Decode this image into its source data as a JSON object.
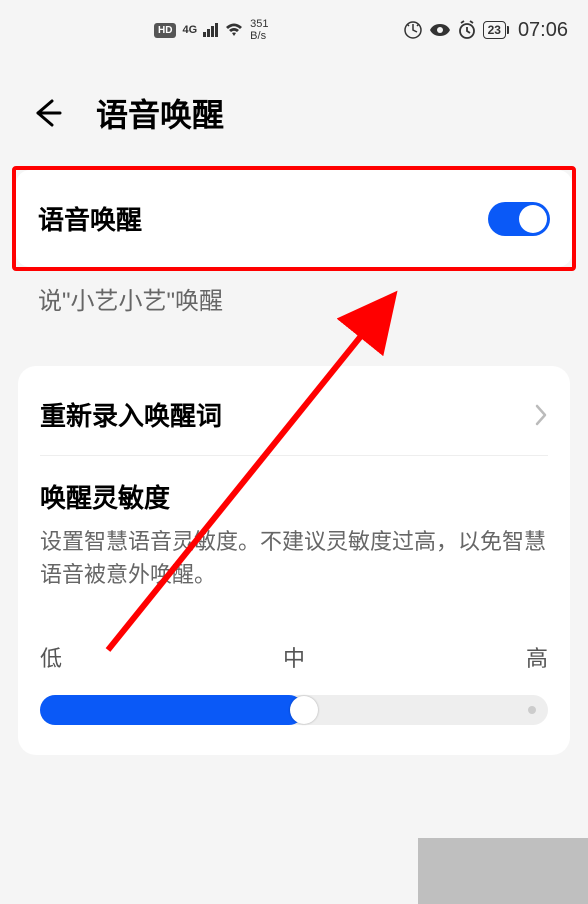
{
  "status": {
    "hd": "HD",
    "net": "4G",
    "speed_value": "351",
    "speed_unit": "B/s",
    "battery": "23",
    "time": "07:06"
  },
  "header": {
    "title": "语音唤醒"
  },
  "voice_wake": {
    "label": "语音唤醒",
    "toggle_on": true,
    "subtext": "说\"小艺小艺\"唤醒"
  },
  "rerecord": {
    "label": "重新录入唤醒词"
  },
  "sensitivity": {
    "title": "唤醒灵敏度",
    "desc": "设置智慧语音灵敏度。不建议灵敏度过高，以免智慧语音被意外唤醒。",
    "low": "低",
    "mid": "中",
    "high": "高",
    "value_percent": 50
  }
}
